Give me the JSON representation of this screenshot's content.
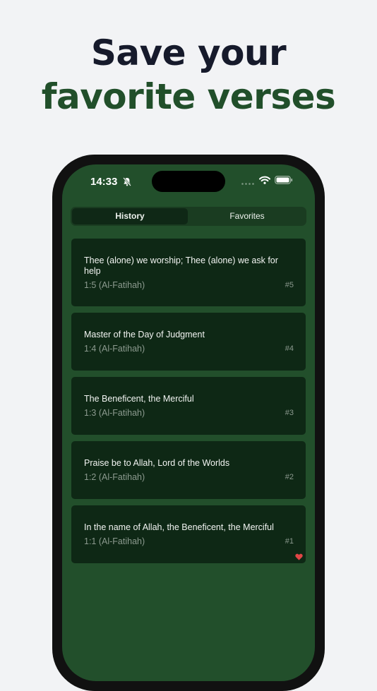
{
  "headline": {
    "line1": "Save your",
    "line2": "favorite verses"
  },
  "status_bar": {
    "time": "14:33",
    "icons": [
      "bell-slash-icon",
      "signal-dots-icon",
      "wifi-icon",
      "battery-icon"
    ]
  },
  "tabs": [
    {
      "label": "History",
      "selected": true
    },
    {
      "label": "Favorites",
      "selected": false
    }
  ],
  "verses": [
    {
      "text": "Thee (alone) we worship; Thee (alone) we ask for help",
      "ref": "1:5 (Al-Fatihah)",
      "num": "#5",
      "favorite": false
    },
    {
      "text": "Master of the Day of Judgment",
      "ref": "1:4 (Al-Fatihah)",
      "num": "#4",
      "favorite": false
    },
    {
      "text": "The Beneficent, the Merciful",
      "ref": "1:3 (Al-Fatihah)",
      "num": "#3",
      "favorite": false
    },
    {
      "text": "Praise be to Allah, Lord of the Worlds",
      "ref": "1:2 (Al-Fatihah)",
      "num": "#2",
      "favorite": false
    },
    {
      "text": "In the name of Allah, the Beneficent, the Merciful",
      "ref": "1:1 (Al-Fatihah)",
      "num": "#1",
      "favorite": true
    }
  ],
  "colors": {
    "background": "#f2f3f5",
    "headline_dark": "#161a2b",
    "headline_green": "#214f2a",
    "screen_green": "#224f2b",
    "card": "#0e2815",
    "heart": "#e04646"
  }
}
